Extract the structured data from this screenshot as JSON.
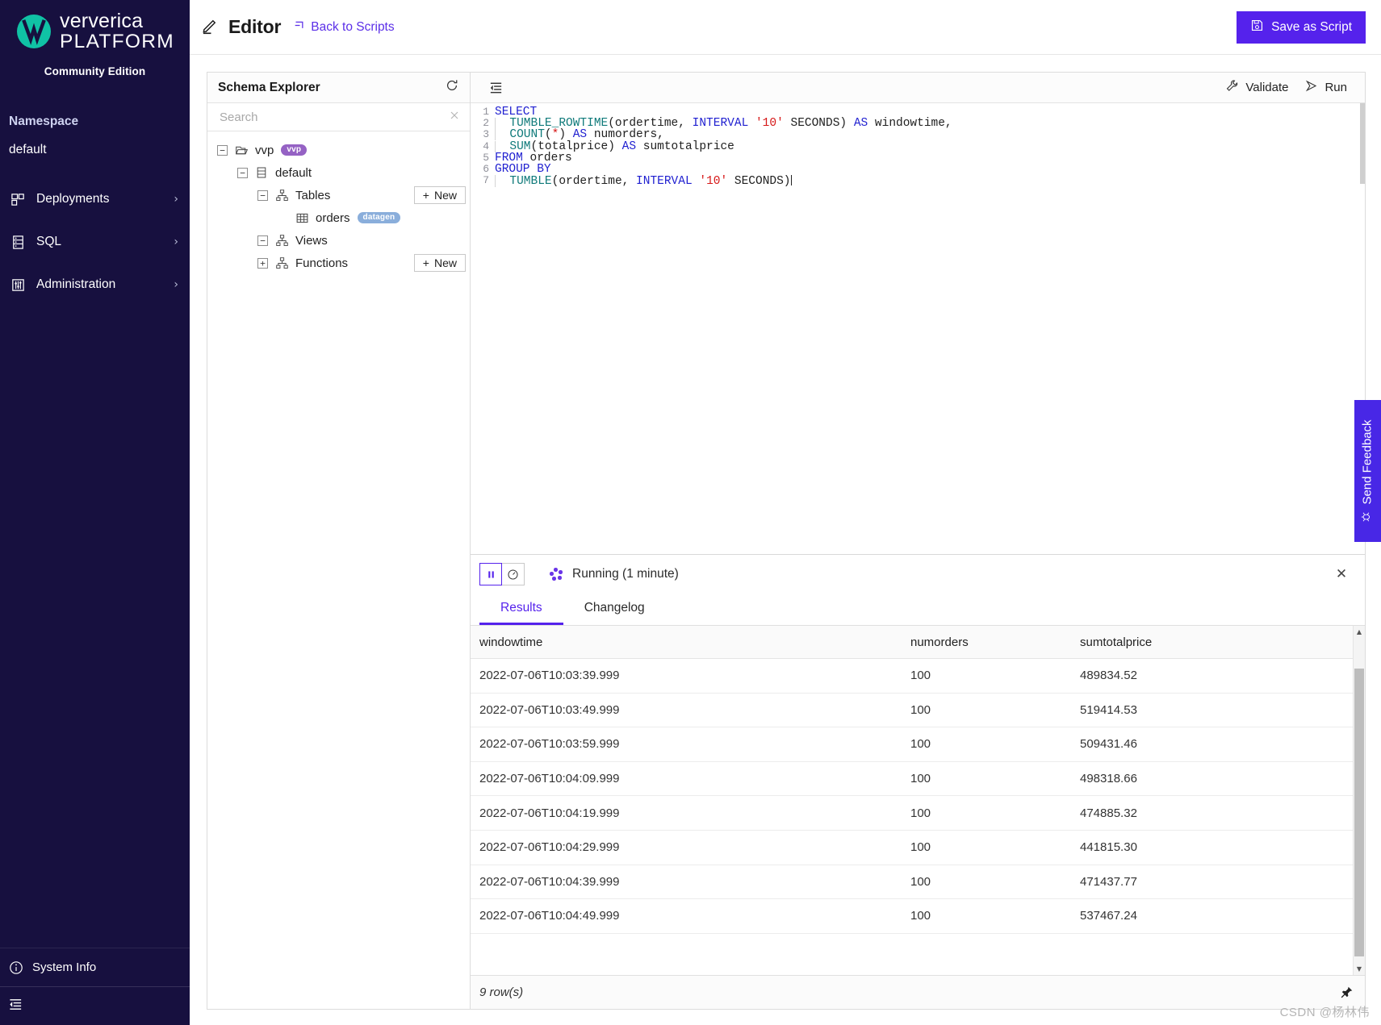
{
  "sidebar": {
    "brand_line1": "ververica",
    "brand_line2": "PLATFORM",
    "edition": "Community Edition",
    "namespace_label": "Namespace",
    "namespace_value": "default",
    "nav": [
      {
        "label": "Deployments",
        "icon": "deployments-icon",
        "chevron": "›"
      },
      {
        "label": "SQL",
        "icon": "sql-icon",
        "chevron": "›"
      },
      {
        "label": "Administration",
        "icon": "administration-icon",
        "chevron": "›"
      }
    ],
    "system_info": "System Info"
  },
  "topbar": {
    "title": "Editor",
    "back_link": "Back to Scripts",
    "save_button": "Save as Script"
  },
  "schema": {
    "title": "Schema Explorer",
    "search_placeholder": "Search",
    "search_value": "",
    "new_label": "New",
    "tree": [
      {
        "label": "vvp",
        "badge": "vvp",
        "badge_kind": "vvp",
        "toggle": "−",
        "icon": "folder-icon",
        "depth": 0,
        "new": false
      },
      {
        "label": "default",
        "badge": "",
        "badge_kind": "",
        "toggle": "−",
        "icon": "catalog-icon",
        "depth": 1,
        "new": false
      },
      {
        "label": "Tables",
        "badge": "",
        "badge_kind": "",
        "toggle": "−",
        "icon": "hierarchy-icon",
        "depth": 2,
        "new": true
      },
      {
        "label": "orders",
        "badge": "datagen",
        "badge_kind": "datagen",
        "toggle": "",
        "icon": "table-icon",
        "depth": 3,
        "new": false
      },
      {
        "label": "Views",
        "badge": "",
        "badge_kind": "",
        "toggle": "−",
        "icon": "hierarchy-icon",
        "depth": 2,
        "new": false
      },
      {
        "label": "Functions",
        "badge": "",
        "badge_kind": "",
        "toggle": "+",
        "icon": "hierarchy-icon",
        "depth": 2,
        "new": true
      }
    ]
  },
  "editor": {
    "validate_label": "Validate",
    "run_label": "Run",
    "lines": [
      {
        "n": "1",
        "indent": false,
        "tokens": [
          {
            "t": "SELECT",
            "c": "k"
          }
        ]
      },
      {
        "n": "2",
        "indent": true,
        "tokens": [
          {
            "t": "  ",
            "c": ""
          },
          {
            "t": "TUMBLE_ROWTIME",
            "c": "fn"
          },
          {
            "t": "(ordertime, ",
            "c": ""
          },
          {
            "t": "INTERVAL",
            "c": "k"
          },
          {
            "t": " ",
            "c": ""
          },
          {
            "t": "'10'",
            "c": "str"
          },
          {
            "t": " SECONDS) ",
            "c": ""
          },
          {
            "t": "AS",
            "c": "k"
          },
          {
            "t": " windowtime,",
            "c": ""
          }
        ]
      },
      {
        "n": "3",
        "indent": true,
        "tokens": [
          {
            "t": "  ",
            "c": ""
          },
          {
            "t": "COUNT",
            "c": "fn"
          },
          {
            "t": "(",
            "c": ""
          },
          {
            "t": "*",
            "c": "str"
          },
          {
            "t": ") ",
            "c": ""
          },
          {
            "t": "AS",
            "c": "k"
          },
          {
            "t": " numorders,",
            "c": ""
          }
        ]
      },
      {
        "n": "4",
        "indent": true,
        "tokens": [
          {
            "t": "  ",
            "c": ""
          },
          {
            "t": "SUM",
            "c": "fn"
          },
          {
            "t": "(totalprice) ",
            "c": ""
          },
          {
            "t": "AS",
            "c": "k"
          },
          {
            "t": " sumtotalprice",
            "c": ""
          }
        ]
      },
      {
        "n": "5",
        "indent": false,
        "tokens": [
          {
            "t": "FROM",
            "c": "k"
          },
          {
            "t": " orders",
            "c": ""
          }
        ]
      },
      {
        "n": "6",
        "indent": false,
        "tokens": [
          {
            "t": "GROUP BY",
            "c": "k"
          }
        ]
      },
      {
        "n": "7",
        "indent": true,
        "tokens": [
          {
            "t": "  ",
            "c": ""
          },
          {
            "t": "TUMBLE",
            "c": "fn"
          },
          {
            "t": "(ordertime, ",
            "c": ""
          },
          {
            "t": "INTERVAL",
            "c": "k"
          },
          {
            "t": " ",
            "c": ""
          },
          {
            "t": "'10'",
            "c": "str"
          },
          {
            "t": " SECONDS)",
            "c": ""
          }
        ]
      }
    ]
  },
  "results": {
    "status": "Running (1 minute)",
    "tabs": [
      {
        "label": "Results",
        "active": true
      },
      {
        "label": "Changelog",
        "active": false
      }
    ],
    "columns": [
      "windowtime",
      "numorders",
      "sumtotalprice"
    ],
    "rows": [
      [
        "2022-07-06T10:03:39.999",
        "100",
        "489834.52"
      ],
      [
        "2022-07-06T10:03:49.999",
        "100",
        "519414.53"
      ],
      [
        "2022-07-06T10:03:59.999",
        "100",
        "509431.46"
      ],
      [
        "2022-07-06T10:04:09.999",
        "100",
        "498318.66"
      ],
      [
        "2022-07-06T10:04:19.999",
        "100",
        "474885.32"
      ],
      [
        "2022-07-06T10:04:29.999",
        "100",
        "441815.30"
      ],
      [
        "2022-07-06T10:04:39.999",
        "100",
        "471437.77"
      ],
      [
        "2022-07-06T10:04:49.999",
        "100",
        "537467.24"
      ]
    ],
    "row_count": "9 row(s)"
  },
  "feedback": {
    "label": "Send Feedback"
  },
  "watermark": "CSDN @杨林伟",
  "colors": {
    "sidebar_bg": "#17103f",
    "accent": "#5522ec",
    "brand_teal": "#10c2a5",
    "badge_vvp": "#9562c4",
    "badge_datagen": "#8aaedb",
    "feedback_bg": "#4827e6"
  }
}
